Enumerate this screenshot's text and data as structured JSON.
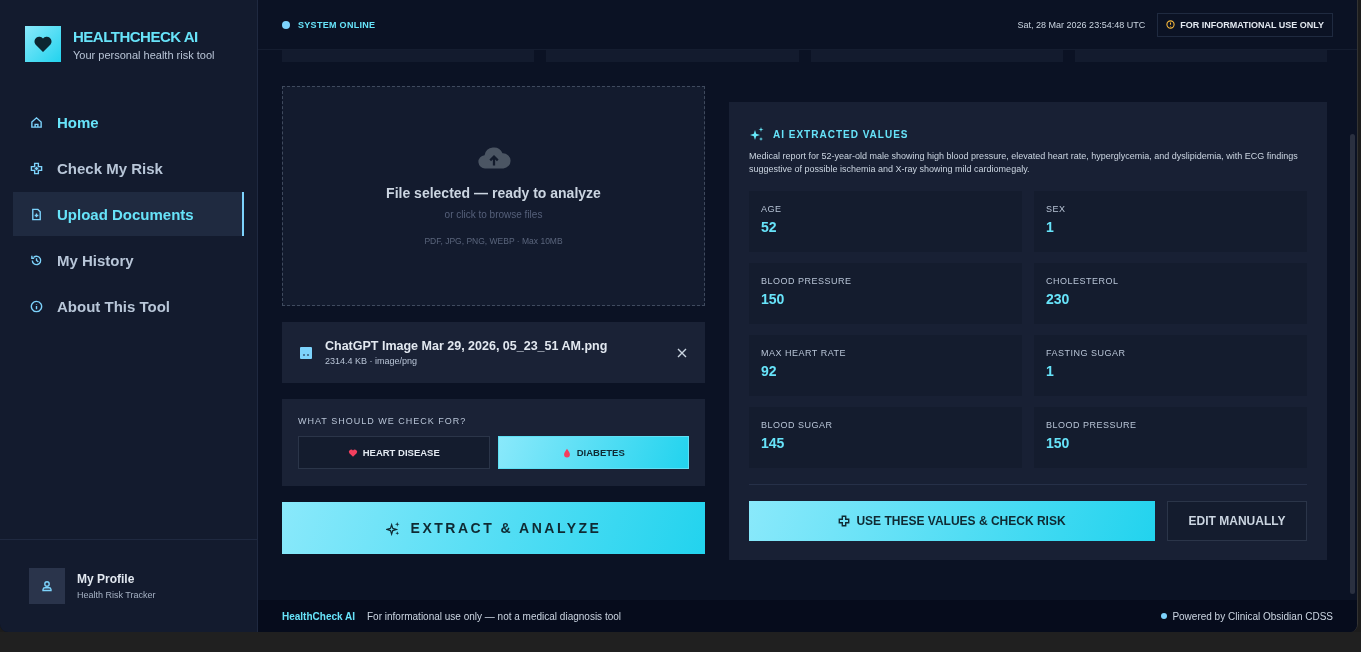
{
  "brand": {
    "title": "HEALTHCHECK AI",
    "subtitle": "Your personal health risk tool"
  },
  "nav": [
    {
      "label": "Home",
      "kind": "home",
      "selected": false
    },
    {
      "label": "Check My Risk",
      "kind": "plus",
      "selected": false
    },
    {
      "label": "Upload Documents",
      "kind": "file",
      "selected": true
    },
    {
      "label": "My History",
      "kind": "history",
      "selected": false
    },
    {
      "label": "About This Tool",
      "kind": "info",
      "selected": false
    }
  ],
  "profile": {
    "name": "My Profile",
    "subtitle": "Health Risk Tracker"
  },
  "topbar": {
    "status": "SYSTEM ONLINE",
    "datetime": "Sat, 28 Mar 2026 23:54:48 UTC",
    "notice": "FOR INFORMATIONAL USE ONLY"
  },
  "dropzone": {
    "title": "File selected — ready to analyze",
    "hint": "or click to browse files",
    "formats": "PDF, JPG, PNG, WEBP · Max 10MB"
  },
  "file": {
    "name": "ChatGPT Image Mar 29, 2026, 05_23_51 AM.png",
    "meta": "2314.4 KB · image/png"
  },
  "check": {
    "label": "WHAT SHOULD WE CHECK FOR?",
    "options": [
      {
        "label": "HEART DISEASE",
        "kind": "heart",
        "selected": false
      },
      {
        "label": "DIABETES",
        "kind": "drop",
        "selected": true
      }
    ]
  },
  "extract_button": "EXTRACT & ANALYZE",
  "ai": {
    "title": "AI EXTRACTED VALUES",
    "summary": "Medical report for 52-year-old male showing high blood pressure, elevated heart rate, hyperglycemia, and dyslipidemia, with ECG findings suggestive of possible ischemia and X-ray showing mild cardiomegaly.",
    "fields": [
      {
        "label": "AGE",
        "value": "52"
      },
      {
        "label": "SEX",
        "value": "1"
      },
      {
        "label": "BLOOD PRESSURE",
        "value": "150"
      },
      {
        "label": "CHOLESTEROL",
        "value": "230"
      },
      {
        "label": "MAX HEART RATE",
        "value": "92"
      },
      {
        "label": "FASTING SUGAR",
        "value": "1"
      },
      {
        "label": "BLOOD SUGAR",
        "value": "145"
      },
      {
        "label": "BLOOD PRESSURE",
        "value": "150"
      }
    ],
    "use_button": "USE THESE VALUES & CHECK RISK",
    "edit_button": "EDIT MANUALLY"
  },
  "footer": {
    "brand": "HealthCheck AI",
    "note": "For informational use only — not a medical diagnosis tool",
    "powered": "Powered by Clinical Obsidian CDSS"
  }
}
